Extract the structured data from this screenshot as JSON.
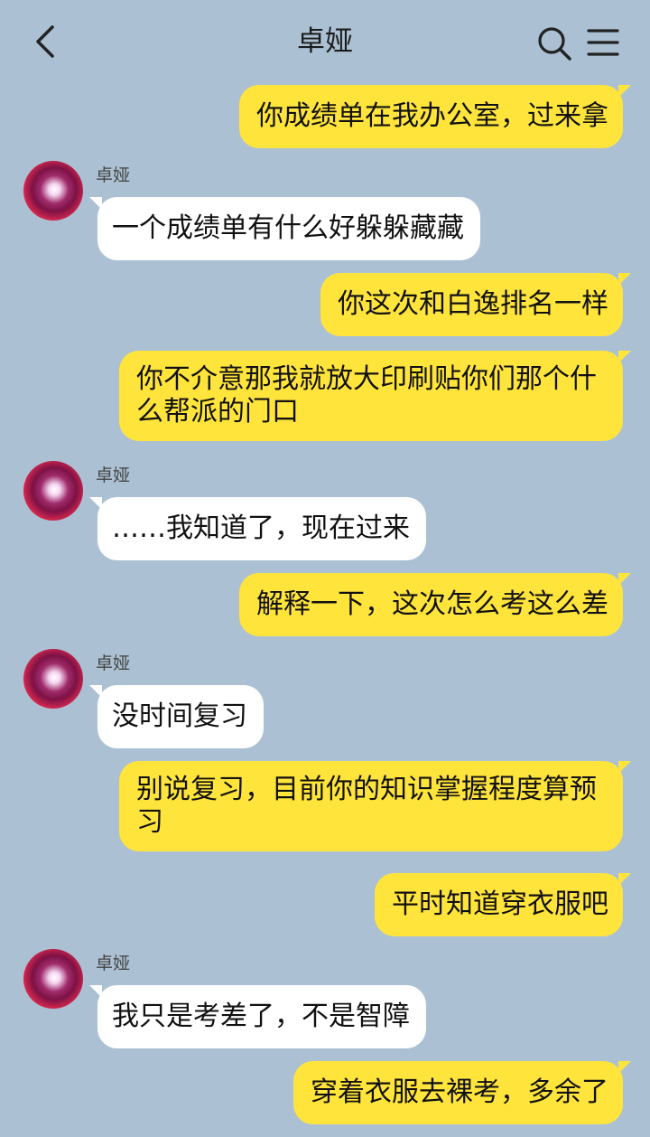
{
  "header": {
    "title": "卓娅",
    "back_icon": "chevron-left-icon",
    "search_icon": "search-icon",
    "menu_icon": "hamburger-menu-icon"
  },
  "colors": {
    "background": "#abc1d3",
    "outgoing_bubble": "#ffe43c",
    "incoming_bubble": "#ffffff"
  },
  "messages": [
    {
      "side": "out",
      "text": "你成绩单在我办公室，过来拿"
    },
    {
      "side": "in",
      "sender": "卓娅",
      "text": "一个成绩单有什么好躲躲藏藏"
    },
    {
      "side": "out",
      "text": "你这次和白逸排名一样"
    },
    {
      "side": "out",
      "text": "你不介意那我就放大印刷贴你们那个什么帮派的门口"
    },
    {
      "side": "in",
      "sender": "卓娅",
      "text": "……我知道了，现在过来"
    },
    {
      "side": "out",
      "text": "解释一下，这次怎么考这么差"
    },
    {
      "side": "in",
      "sender": "卓娅",
      "text": "没时间复习"
    },
    {
      "side": "out",
      "text": "别说复习，目前你的知识掌握程度算预习"
    },
    {
      "side": "out",
      "text": "平时知道穿衣服吧"
    },
    {
      "side": "in",
      "sender": "卓娅",
      "text": "我只是考差了，不是智障"
    },
    {
      "side": "out",
      "text": "穿着衣服去裸考，多余了"
    }
  ]
}
